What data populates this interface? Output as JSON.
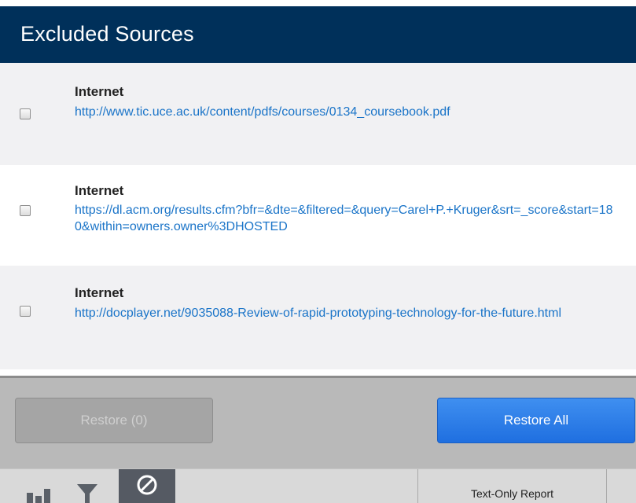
{
  "header": {
    "title": "Excluded Sources"
  },
  "sources": [
    {
      "type": "Internet",
      "url": "http://www.tic.uce.ac.uk/content/pdfs/courses/0134_coursebook.pdf",
      "checked": false
    },
    {
      "type": "Internet",
      "url": "https://dl.acm.org/results.cfm?bfr=&dte=&filtered=&query=Carel+P.+Kruger&srt=_score&start=180&within=owners.owner%3DHOSTED",
      "checked": false
    },
    {
      "type": "Internet",
      "url": "http://docplayer.net/9035088-Review-of-rapid-prototyping-technology-for-the-future.html",
      "checked": false
    }
  ],
  "actions": {
    "restore_label": "Restore (0)",
    "restore_all_label": "Restore All"
  },
  "toolbar": {
    "icons": [
      "bar-chart-icon",
      "filter-icon",
      "exclude-icon"
    ],
    "text_only_report_label": "Text-Only Report"
  },
  "colors": {
    "header_bg": "#00305a",
    "link": "#1a74c8",
    "primary_button": "#2b7de9"
  }
}
